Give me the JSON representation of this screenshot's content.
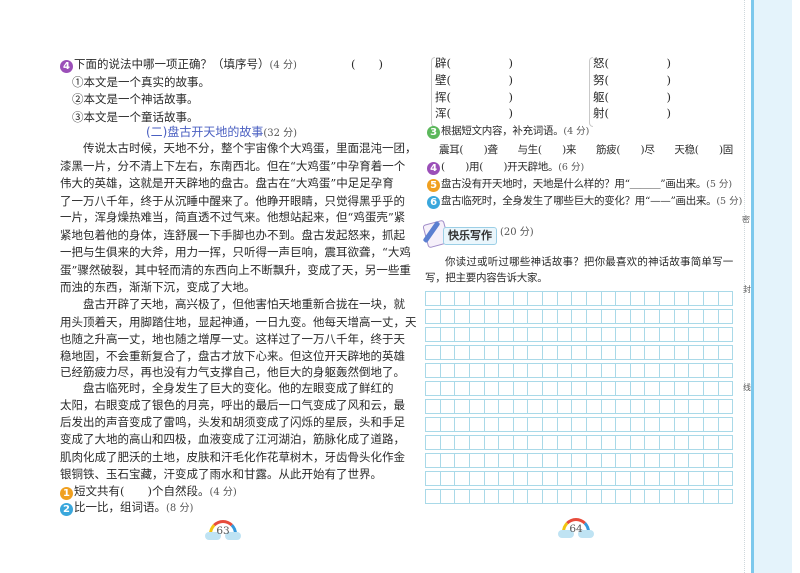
{
  "left_page": {
    "q4": {
      "num": "4",
      "text": "下面的说法中哪一项正确？（填序号）",
      "score": "(4 分)",
      "answer": "(　　)",
      "options": [
        "①本文是一个真实的故事。",
        "②本文是一个神话故事。",
        "③本文是一个童话故事。"
      ]
    },
    "section_title": "(二)盘古开天地的故事",
    "section_score": "(32 分)",
    "paragraphs": [
      [
        "传说太古时候，天地不分，整个宇宙像个大鸡蛋，里面混沌一团，",
        "漆黑一片，分不清上下左右，东南西北。但在“大鸡蛋”中孕育着一个",
        "伟大的英雄，这就是开天辟地的盘古。盘古在“大鸡蛋”中足足孕育",
        "了一万八千年，终于从沉睡中醒来了。他睁开眼睛，只觉得黑乎乎的",
        "一片，浑身燥热难当，简直透不过气来。他想站起来，但“鸡蛋壳”紧",
        "紧地包着他的身体，连舒展一下手脚也办不到。盘古发起怒来，抓起",
        "一把与生俱来的大斧，用力一挥，只听得一声巨响，震耳欲聋，“大鸡",
        "蛋”骤然破裂，其中轻而清的东西向上不断飘升，变成了天，另一些重",
        "而浊的东西，渐渐下沉，变成了大地。"
      ],
      [
        "盘古开辟了天地，高兴极了，但他害怕天地重新合拢在一块，就",
        "用头顶着天，用脚踏住地，显起神通，一日九变。他每天增高一丈，天",
        "也随之升高一丈，地也随之增厚一丈。这样过了一万八千年，终于天",
        "稳地固，不会重新复合了，盘古才放下心来。但这位开天辟地的英雄",
        "已经筋疲力尽，再也没有力气支撑自己，他巨大的身躯轰然倒地了。"
      ],
      [
        "盘古临死时，全身发生了巨大的变化。他的左眼变成了鲜红的",
        "太阳，右眼变成了银色的月亮，呼出的最后一口气变成了风和云，最",
        "后发出的声音变成了雷鸣，头发和胡须变成了闪烁的星辰，头和手足",
        "变成了大地的高山和四极，血液变成了江河湖泊，筋脉化成了道路，",
        "肌肉化成了肥沃的土地，皮肤和汗毛化作花草树木，牙齿骨头化作金",
        "银铜铁、玉石宝藏，汗变成了雨水和甘露。从此开始有了世界。"
      ]
    ],
    "q1": {
      "num": "1",
      "text": "短文共有(　　)个自然段。",
      "score": "(4 分)"
    },
    "q2": {
      "num": "2",
      "text": "比一比，组词语。",
      "score": "(8 分)"
    },
    "page_number": "63"
  },
  "right_page": {
    "compare_left": [
      "辟(　　　　　)",
      "壁(　　　　　)",
      "挥(　　　　　)",
      "浑(　　　　　)"
    ],
    "compare_right": [
      "怒(　　　　　)",
      "努(　　　　　)",
      "躯(　　　　　)",
      "射(　　　　　)"
    ],
    "q3": {
      "num": "3",
      "text": "根据短文内容，补充词语。",
      "score": "(4 分)",
      "blanks": [
        "震耳(　　)聋",
        "与生(　　)来",
        "筋疲(　　)尽",
        "天稳(　　)固"
      ]
    },
    "q4": {
      "num": "4",
      "text": "(　　)用(　　)开天辟地。",
      "score": "(6 分)"
    },
    "q5": {
      "num": "5",
      "text": "盘古没有开天地时，天地是什么样的？用“＿＿＿”画出来。",
      "score": "(5 分)"
    },
    "q6": {
      "num": "6",
      "text": "盘古临死时，全身发生了哪些巨大的变化？用“——”画出来。",
      "score": "(5 分)"
    },
    "writing": {
      "banner": "快乐写作",
      "score": "(20 分)",
      "prompt": [
        "你读过或听过哪些神话故事？把你最喜欢的神话故事简单写一",
        "写，把主要内容告诉大家。"
      ]
    },
    "grid": {
      "rows": 12,
      "cols": 21
    },
    "page_number": "64"
  },
  "margin_labels": [
    "密",
    "封",
    "线"
  ],
  "colors": {
    "purple": "#9b4fb8",
    "orange": "#f0a020",
    "blue": "#3aa7dc",
    "green": "#5cb85c",
    "title": "#4a5fc1",
    "side_panel": "#e4f3fb",
    "side_line": "#7cc8ec"
  }
}
